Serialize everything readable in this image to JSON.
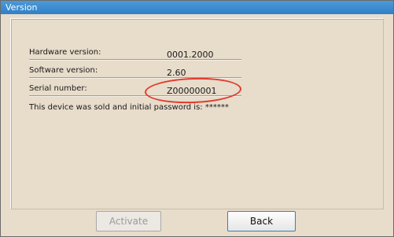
{
  "window": {
    "title": "Version"
  },
  "info": {
    "hardware_label": "Hardware version:",
    "hardware_value": "0001.2000",
    "software_label": "Software version:",
    "software_value": "2.60",
    "serial_label": "Serial number:",
    "serial_value": "Z00000001",
    "sold_note": "This device was sold and initial password is: ******"
  },
  "buttons": {
    "activate_label": "Activate",
    "activate_enabled": false,
    "back_label": "Back"
  },
  "colors": {
    "highlight": "#e23a2c",
    "titlebar": "#2f80c8",
    "background": "#e8dccb"
  }
}
